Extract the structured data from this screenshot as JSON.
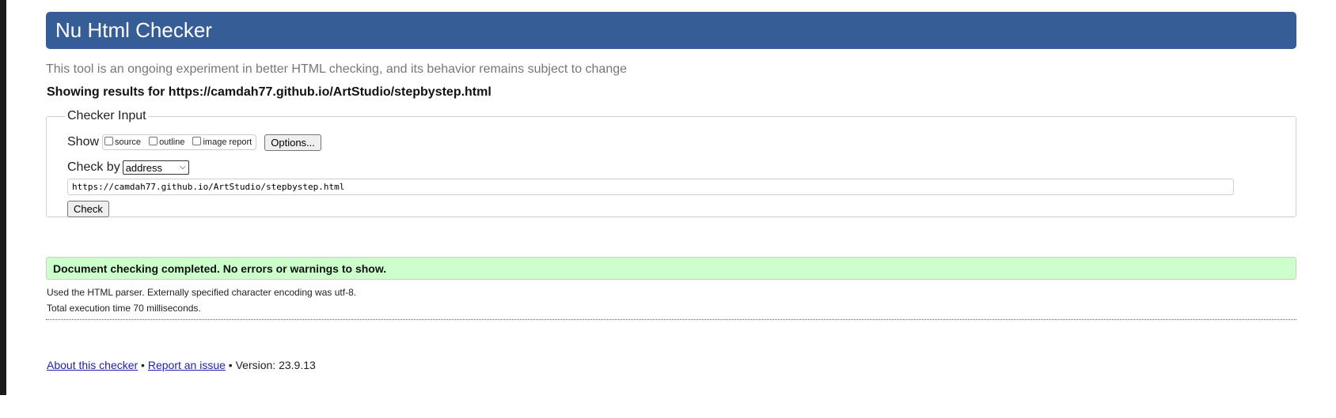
{
  "header": {
    "title": "Nu Html Checker"
  },
  "subtitle": "This tool is an ongoing experiment in better HTML checking, and its behavior remains subject to change",
  "results_heading": "Showing results for https://camdah77.github.io/ArtStudio/stepbystep.html",
  "checker_input": {
    "legend": "Checker Input",
    "show_label": "Show",
    "options": [
      {
        "label": "source",
        "checked": false
      },
      {
        "label": "outline",
        "checked": false
      },
      {
        "label": "image report",
        "checked": false
      }
    ],
    "options_button": "Options...",
    "check_by_label": "Check by",
    "check_by_value": "address",
    "url_value": "https://camdah77.github.io/ArtStudio/stepbystep.html",
    "check_button": "Check"
  },
  "result": {
    "message": "Document checking completed. No errors or warnings to show.",
    "parser_note": "Used the HTML parser. Externally specified character encoding was utf-8.",
    "execution_time": "Total execution time 70 milliseconds."
  },
  "footer": {
    "about_link": "About this checker",
    "separator": " • ",
    "report_link": "Report an issue",
    "version": "Version: 23.9.13"
  },
  "colors": {
    "header_bg": "#365d95",
    "success_bg": "#ccffcc"
  }
}
